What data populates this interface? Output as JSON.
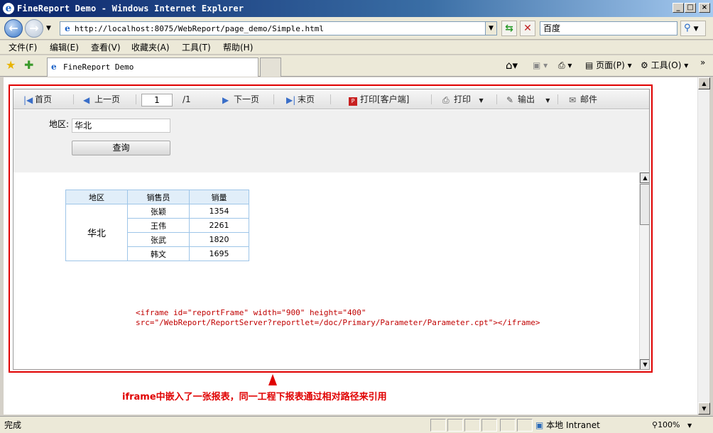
{
  "window": {
    "title": "FineReport Demo - Windows Internet Explorer"
  },
  "address": {
    "url": "http://localhost:8075/WebReport/page_demo/Simple.html",
    "search_placeholder": "百度"
  },
  "menu": [
    "文件(F)",
    "编辑(E)",
    "查看(V)",
    "收藏夹(A)",
    "工具(T)",
    "帮助(H)"
  ],
  "tab": {
    "label": "FineReport Demo"
  },
  "ie_toolbar": {
    "page_label": "页面(P)",
    "tools_label": "工具(O)"
  },
  "report_toolbar": {
    "first": "首页",
    "prev": "上一页",
    "page_value": "1",
    "total": "/1",
    "next": "下一页",
    "last": "末页",
    "print_client": "打印[客户端]",
    "print": "打印",
    "export": "输出",
    "mail": "邮件"
  },
  "params": {
    "region_label": "地区:",
    "region_value": "华北",
    "query_label": "查询"
  },
  "report_table": {
    "headers": [
      "地区",
      "销售员",
      "销量"
    ],
    "region": "华北",
    "rows": [
      {
        "salesman": "张颖",
        "amount": "1354"
      },
      {
        "salesman": "王伟",
        "amount": "2261"
      },
      {
        "salesman": "张武",
        "amount": "1820"
      },
      {
        "salesman": "韩文",
        "amount": "1695"
      }
    ]
  },
  "code": {
    "line1": "<iframe id=\"reportFrame\" width=\"900\" height=\"400\"",
    "line2": "src=\"/WebReport/ReportServer?reportlet=/doc/Primary/Parameter/Parameter.cpt\"></iframe>"
  },
  "annotation": "iframe中嵌入了一张报表，同一工程下报表通过相对路径来引用",
  "status": {
    "text": "完成",
    "zone": "本地 Intranet",
    "zoom": "100%"
  },
  "colors": {
    "accent_red": "#e00000",
    "code_red": "#c00000",
    "table_border": "#9ec5e8"
  }
}
